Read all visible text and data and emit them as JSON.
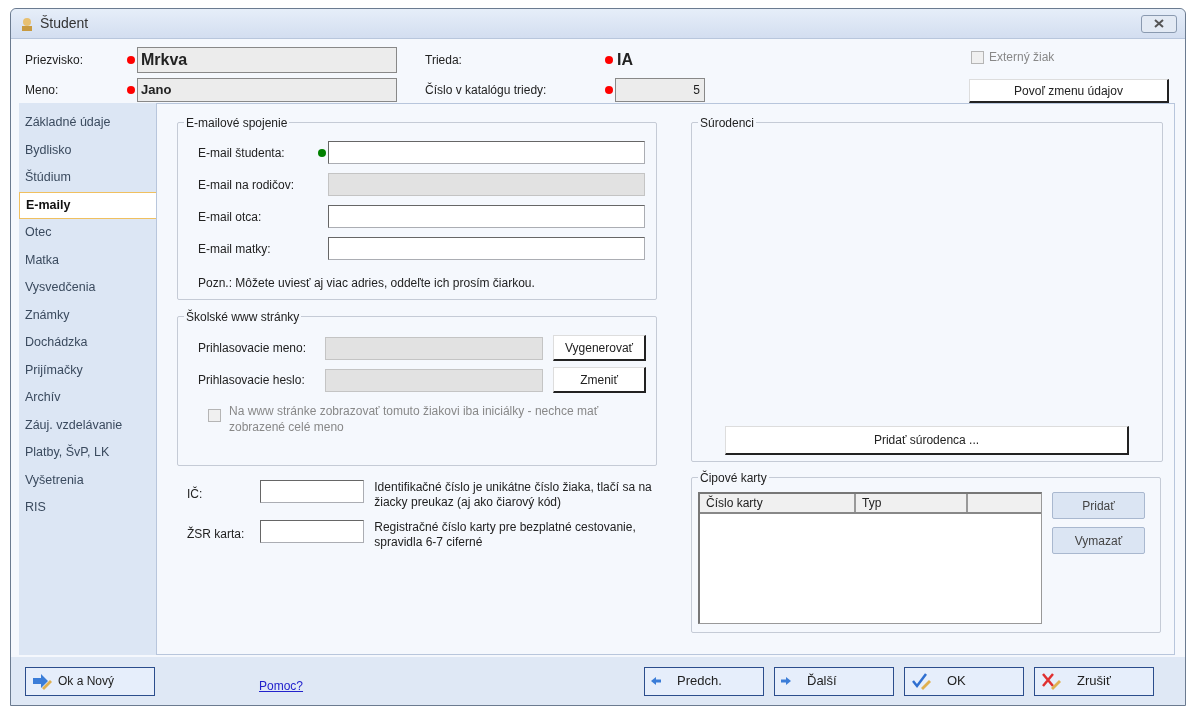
{
  "window": {
    "title": "Študent"
  },
  "header": {
    "surname": {
      "label": "Priezvisko:",
      "value": "Mrkva",
      "color": "#ff0000"
    },
    "name": {
      "label": "Meno:",
      "value": "Jano",
      "color": "#ff0000"
    },
    "class": {
      "label": "Trieda:",
      "value": "IA",
      "color": "#ff0000"
    },
    "catalog": {
      "label": "Číslo v katalógu triedy:",
      "value": "5",
      "color": "#ff0000"
    },
    "external": {
      "label": "Externý žiak",
      "checked": false,
      "disabled": true
    },
    "unlock_button": "Povoľ zmenu údajov"
  },
  "sidebar": {
    "items": [
      {
        "label": "Základné údaje",
        "selected": false
      },
      {
        "label": "Bydlisko",
        "selected": false
      },
      {
        "label": "Štúdium",
        "selected": false
      },
      {
        "label": "E-maily",
        "selected": true
      },
      {
        "label": "Otec",
        "selected": false
      },
      {
        "label": "Matka",
        "selected": false
      },
      {
        "label": "Vysvedčenia",
        "selected": false
      },
      {
        "label": "Známky",
        "selected": false
      },
      {
        "label": "Dochádzka",
        "selected": false
      },
      {
        "label": "Prijímačky",
        "selected": false
      },
      {
        "label": "Archív",
        "selected": false
      },
      {
        "label": "Záuj. vzdelávanie",
        "selected": false
      },
      {
        "label": "Platby, ŠvP, LK",
        "selected": false
      },
      {
        "label": "Vyšetrenia",
        "selected": false
      },
      {
        "label": "RIS",
        "selected": false
      }
    ]
  },
  "email_group": {
    "title": "E-mailové spojenie",
    "fields": [
      {
        "label": "E-mail študenta:",
        "color": "#008000",
        "disabled": false
      },
      {
        "label": "E-mail na rodičov:",
        "disabled": true
      },
      {
        "label": "E-mail otca:",
        "disabled": false
      },
      {
        "label": "E-mail matky:",
        "disabled": false
      }
    ],
    "note": "Pozn.: Môžete uviesť aj viac adries, oddeľte ich prosím čiarkou."
  },
  "web_group": {
    "title": "Školské www stránky",
    "fields": [
      {
        "label": "Prihlasovacie meno:",
        "disabled": true,
        "button": "Vygenerovať"
      },
      {
        "label": "Prihlasovacie heslo:",
        "disabled": true,
        "button": "Zmeniť"
      }
    ],
    "initials": {
      "label": "Na www stránke zobrazovať tomuto žiakovi iba iniciálky - nechce mať zobrazené celé meno",
      "checked": false,
      "disabled": true
    }
  },
  "id_fields": [
    {
      "label": "IČ:",
      "hint": "Identifikačné číslo je unikátne číslo žiaka, tlačí sa na žiacky preukaz (aj ako čiarový kód)"
    },
    {
      "label": "ŽSR karta:",
      "hint": "Registračné číslo karty pre bezplatné cestovanie, spravidla 6-7 ciferné"
    }
  ],
  "siblings": {
    "title": "Súrodenci",
    "button": "Pridať súrodenca ..."
  },
  "chip_cards": {
    "title": "Čipové karty",
    "columns": [
      "Číslo karty",
      "Typ"
    ],
    "buttons": [
      "Pridať",
      "Vymazať"
    ]
  },
  "footer": {
    "ok_new": "Ok a Nový",
    "help_link": "Pomoc?",
    "buttons": [
      {
        "kind": "prev",
        "label": "Predch."
      },
      {
        "kind": "next",
        "label": "Ďalší"
      },
      {
        "kind": "ok",
        "label": "OK"
      },
      {
        "kind": "cancel",
        "label": "Zrušiť"
      }
    ]
  }
}
